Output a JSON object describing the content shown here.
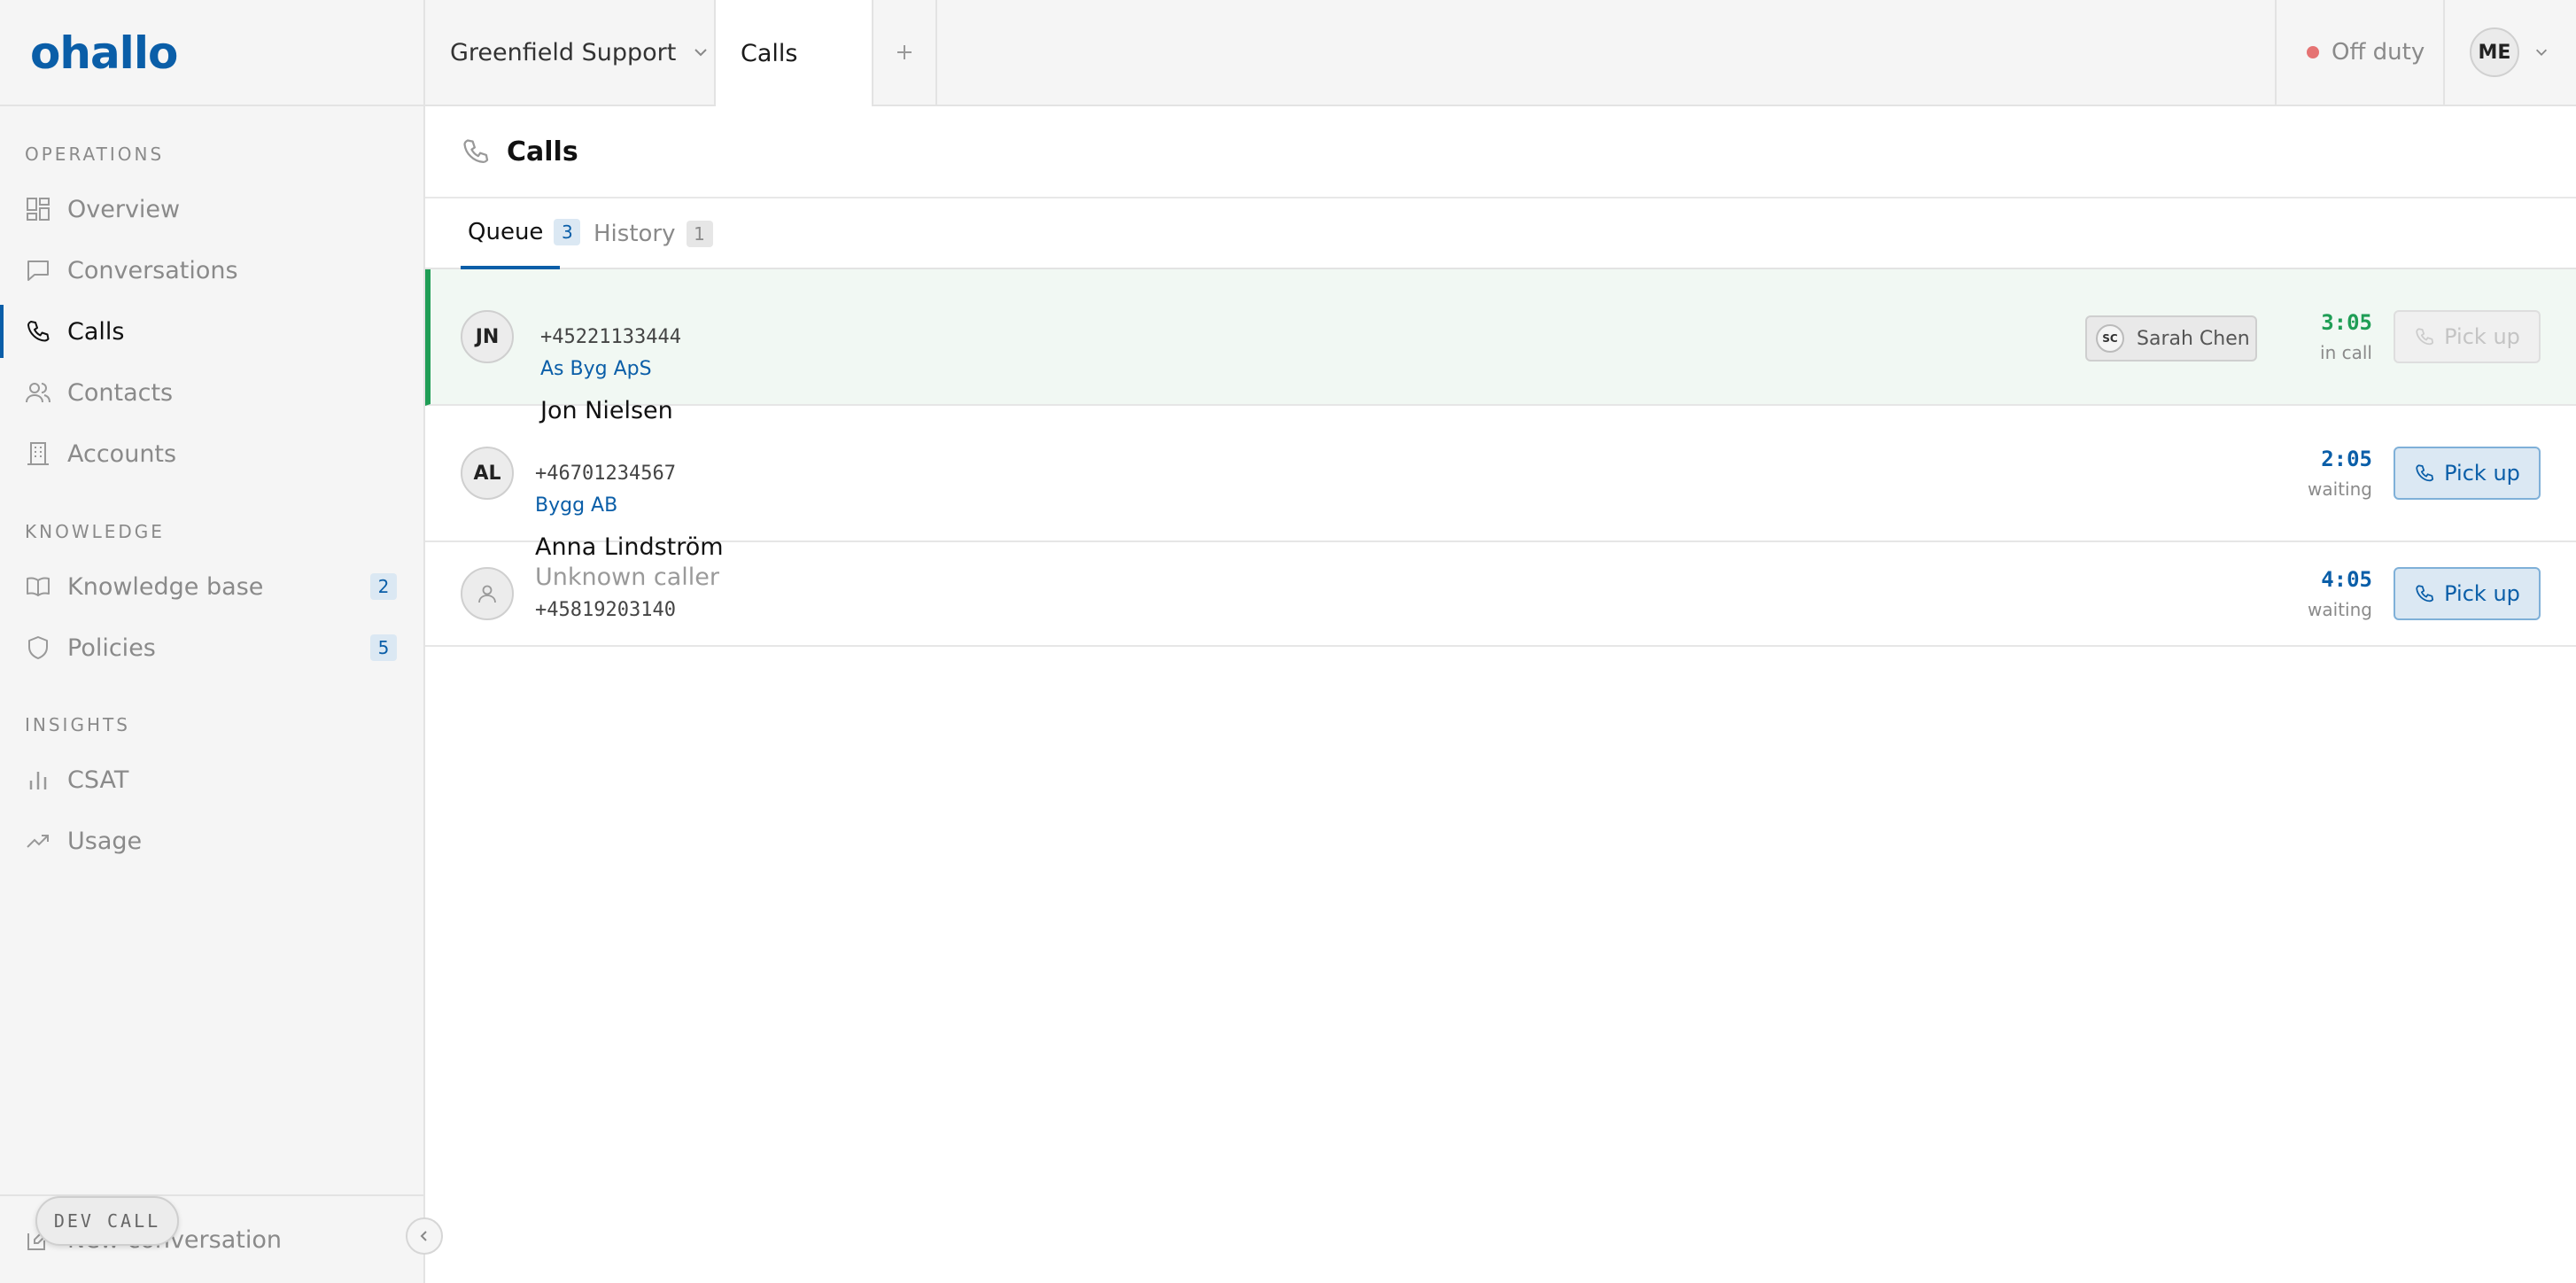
{
  "app": {
    "logo": "ohallo",
    "workspace": "Greenfield Support",
    "open_tab": "Calls",
    "status": "Off duty",
    "user_initials": "ME"
  },
  "sidebar": {
    "sections": [
      {
        "title": "OPERATIONS",
        "items": [
          {
            "label": "Overview",
            "icon": "grid-icon"
          },
          {
            "label": "Conversations",
            "icon": "chat-icon"
          },
          {
            "label": "Calls",
            "icon": "phone-icon",
            "active": true
          },
          {
            "label": "Contacts",
            "icon": "users-icon"
          },
          {
            "label": "Accounts",
            "icon": "building-icon"
          }
        ]
      },
      {
        "title": "KNOWLEDGE",
        "items": [
          {
            "label": "Knowledge base",
            "icon": "book-icon",
            "badge": "2"
          },
          {
            "label": "Policies",
            "icon": "shield-icon",
            "badge": "5"
          }
        ]
      },
      {
        "title": "INSIGHTS",
        "items": [
          {
            "label": "CSAT",
            "icon": "bar-chart-icon"
          },
          {
            "label": "Usage",
            "icon": "trend-icon"
          }
        ]
      }
    ],
    "footer": {
      "new_conversation": "New conversation",
      "dev_call": "DEV CALL"
    }
  },
  "page": {
    "title": "Calls",
    "tabs": [
      {
        "label": "Queue",
        "count": "3",
        "active": true
      },
      {
        "label": "History",
        "count": "1"
      }
    ]
  },
  "calls": [
    {
      "initials": "JN",
      "name": "Jon Nielsen",
      "phone": "+45221133444",
      "company": "As Byg ApS",
      "agent_initials": "SC",
      "agent": "Sarah Chen",
      "time": "3:05",
      "state": "in call",
      "action": "Pick up",
      "action_enabled": false
    },
    {
      "initials": "AL",
      "name": "Anna Lindström",
      "phone": "+46701234567",
      "company": "Bygg AB",
      "time": "2:05",
      "state": "waiting",
      "action": "Pick up",
      "action_enabled": true
    },
    {
      "name": "Unknown caller",
      "phone": "+45819203140",
      "time": "4:05",
      "state": "waiting",
      "action": "Pick up",
      "action_enabled": true
    }
  ],
  "colors": {
    "brand": "#0a5ea8",
    "active_call": "#1f9d55",
    "status_off": "#e57373"
  }
}
